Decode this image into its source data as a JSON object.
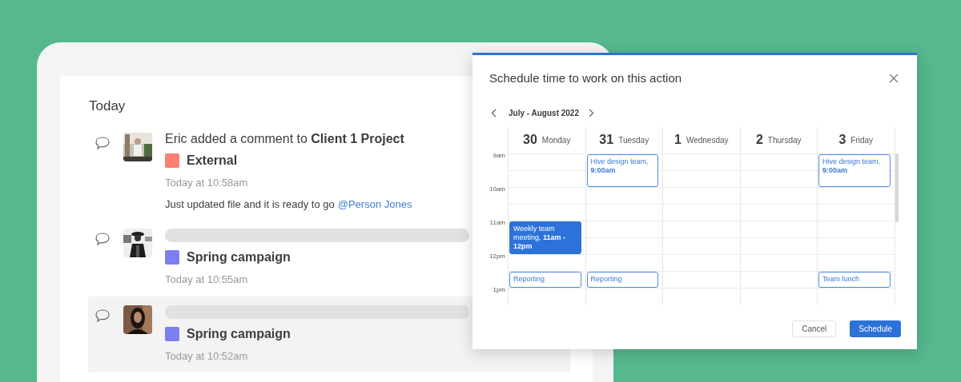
{
  "activity": {
    "heading": "Today",
    "items": [
      {
        "kind": "comment",
        "selected": false,
        "title": "Eric added a comment to **Client 1 Project**",
        "tag": {
          "label": "External",
          "color": "#fa8072"
        },
        "time": "Today at 10:58am",
        "body": "Just updated file and it is ready to go",
        "mention": "@Person Jones"
      },
      {
        "kind": "skeleton",
        "selected": false,
        "tag": {
          "label": "Spring campaign",
          "color": "#7b7ff0"
        },
        "time": "Today at 10:55am"
      },
      {
        "kind": "skeleton",
        "selected": true,
        "tag": {
          "label": "Spring campaign",
          "color": "#7b7ff0"
        },
        "time": "Today at 10:52am"
      }
    ]
  },
  "modal": {
    "title": "Schedule time to work on this action",
    "range": "July - August 2022",
    "time_labels": [
      "9am",
      "10am",
      "11am",
      "12pm",
      "1pm"
    ],
    "days": [
      {
        "date": "30",
        "weekday": "Monday",
        "slots": [
          {
            "kind": "free"
          },
          {
            "kind": "free"
          },
          {
            "kind": "free"
          },
          {
            "kind": "free"
          },
          {
            "kind": "hour",
            "selected": true,
            "text": "Weekly team meeting, **11am - 12pm**"
          },
          {
            "kind": "free"
          },
          {
            "kind": "halfhour",
            "selected": false,
            "text": "Reporting"
          },
          {
            "kind": "free"
          }
        ]
      },
      {
        "date": "31",
        "weekday": "Tuesday",
        "slots": [
          {
            "kind": "hour",
            "selected": false,
            "text": "Hive design team, **9:00am**"
          },
          {
            "kind": "free"
          },
          {
            "kind": "free"
          },
          {
            "kind": "free"
          },
          {
            "kind": "free"
          },
          {
            "kind": "free"
          },
          {
            "kind": "halfhour",
            "selected": false,
            "text": "Reporting"
          },
          {
            "kind": "free"
          }
        ]
      },
      {
        "date": "1",
        "weekday": "Wednesday",
        "slots": [
          {
            "kind": "free"
          },
          {
            "kind": "free"
          },
          {
            "kind": "free"
          },
          {
            "kind": "free"
          },
          {
            "kind": "free"
          },
          {
            "kind": "free"
          },
          {
            "kind": "free"
          },
          {
            "kind": "free"
          },
          {
            "kind": "free"
          }
        ]
      },
      {
        "date": "2",
        "weekday": "Thursday",
        "slots": [
          {
            "kind": "free"
          },
          {
            "kind": "free"
          },
          {
            "kind": "free"
          },
          {
            "kind": "free"
          },
          {
            "kind": "free"
          },
          {
            "kind": "free"
          },
          {
            "kind": "free"
          },
          {
            "kind": "free"
          },
          {
            "kind": "free"
          }
        ]
      },
      {
        "date": "3",
        "weekday": "Friday",
        "slots": [
          {
            "kind": "hour",
            "selected": false,
            "text": "Hive design team, **9:00am**"
          },
          {
            "kind": "free"
          },
          {
            "kind": "free"
          },
          {
            "kind": "free"
          },
          {
            "kind": "free"
          },
          {
            "kind": "free"
          },
          {
            "kind": "halfhour",
            "selected": false,
            "text": "Team lunch"
          },
          {
            "kind": "free"
          }
        ]
      }
    ],
    "buttons": {
      "cancel": "Cancel",
      "confirm": "Schedule"
    }
  }
}
